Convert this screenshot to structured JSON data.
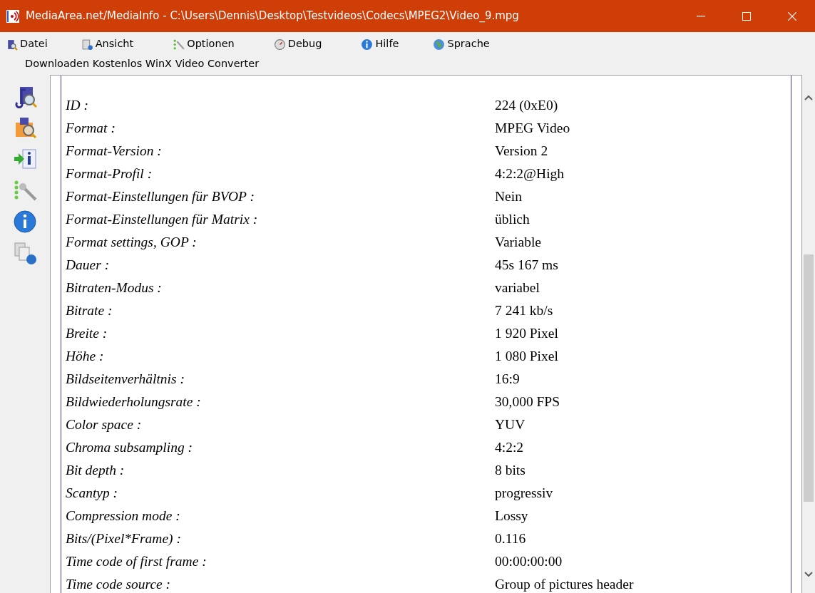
{
  "window": {
    "title": "MediaArea.net/MediaInfo - C:\\Users\\Dennis\\Desktop\\Testvideos\\Codecs\\MPEG2\\Video_9.mpg"
  },
  "menu": [
    {
      "label": "Datei",
      "kind": "file"
    },
    {
      "label": "Ansicht",
      "kind": "view"
    },
    {
      "label": "Optionen",
      "kind": "options"
    },
    {
      "label": "Debug",
      "kind": "debug"
    },
    {
      "label": "Hilfe",
      "kind": "help"
    },
    {
      "label": "Sprache",
      "kind": "language"
    }
  ],
  "promo_link": "Downloaden Kostenlos WinX Video Converter",
  "toolbar": [
    {
      "kind": "open-file"
    },
    {
      "kind": "open-folder"
    },
    {
      "kind": "export"
    },
    {
      "kind": "preferences"
    },
    {
      "kind": "about"
    },
    {
      "kind": "web"
    }
  ],
  "fields": [
    {
      "label": "ID :",
      "value": "224 (0xE0)"
    },
    {
      "label": "Format :",
      "value": "MPEG Video"
    },
    {
      "label": "Format-Version :",
      "value": "Version 2"
    },
    {
      "label": "Format-Profil :",
      "value": "4:2:2@High"
    },
    {
      "label": "Format-Einstellungen für BVOP :",
      "value": "Nein"
    },
    {
      "label": "Format-Einstellungen für Matrix :",
      "value": "üblich"
    },
    {
      "label": "Format settings, GOP :",
      "value": "Variable"
    },
    {
      "label": "Dauer :",
      "value": "45s 167 ms"
    },
    {
      "label": "Bitraten-Modus :",
      "value": "variabel"
    },
    {
      "label": "Bitrate :",
      "value": "7 241 kb/s"
    },
    {
      "label": "Breite :",
      "value": "1 920 Pixel"
    },
    {
      "label": "Höhe :",
      "value": "1 080 Pixel"
    },
    {
      "label": "Bildseitenverhältnis :",
      "value": "16:9"
    },
    {
      "label": "Bildwiederholungsrate :",
      "value": "30,000 FPS"
    },
    {
      "label": "Color space :",
      "value": "YUV"
    },
    {
      "label": "Chroma subsampling :",
      "value": "4:2:2"
    },
    {
      "label": "Bit depth :",
      "value": "8 bits"
    },
    {
      "label": "Scantyp :",
      "value": "progressiv"
    },
    {
      "label": "Compression mode :",
      "value": "Lossy"
    },
    {
      "label": "Bits/(Pixel*Frame) :",
      "value": "0.116"
    },
    {
      "label": "Time code of first frame :",
      "value": "00:00:00:00"
    },
    {
      "label": "Time code source :",
      "value": "Group of pictures header"
    }
  ]
}
